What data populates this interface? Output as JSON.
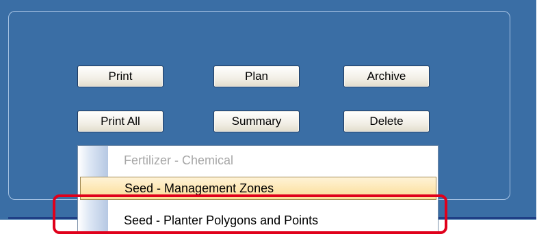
{
  "buttons": {
    "print": "Print",
    "plan": "Plan",
    "archive": "Archive",
    "print_all": "Print All",
    "summary": "Summary",
    "delete": "Delete"
  },
  "menu": {
    "items": [
      {
        "label": "Fertilizer - Chemical",
        "state": "disabled"
      },
      {
        "label": "Seed - Management Zones",
        "state": "hover"
      },
      {
        "label": "Seed - Planter Polygons and Points",
        "state": "normal"
      }
    ]
  },
  "colors": {
    "panel": "#3a6ea5",
    "highlight": "#e0001b",
    "hover": "#fbdc95"
  }
}
